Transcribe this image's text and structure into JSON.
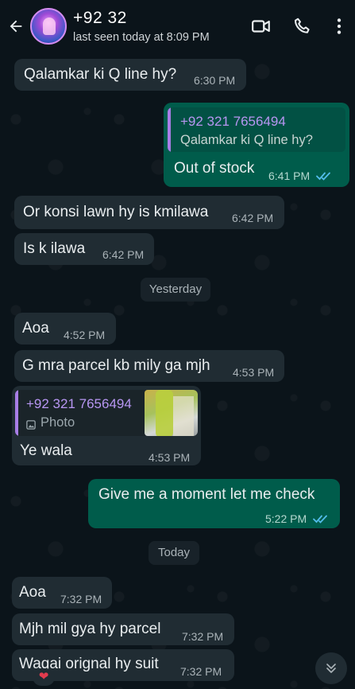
{
  "header": {
    "contact_name": "+92 32",
    "status": "last seen today at 8:09 PM"
  },
  "messages": [
    {
      "text": "Qalamkar ki Q line hy?",
      "time": "6:30 PM"
    },
    {
      "quote_author": "+92 321 7656494",
      "quote_text": "Qalamkar ki Q line hy?",
      "text": "Out of stock",
      "time": "6:41 PM"
    },
    {
      "text": "Or konsi lawn hy is kmilawa",
      "time": "6:42 PM"
    },
    {
      "text": "Is k ilawa",
      "time": "6:42 PM"
    },
    {
      "text": "Aoa",
      "time": "4:52 PM"
    },
    {
      "text": "G mra parcel kb mily ga mjh",
      "time": "4:53 PM"
    },
    {
      "quote_author": "+92 321 7656494",
      "quote_text": "Photo",
      "text": "Ye wala",
      "time": "4:53 PM"
    },
    {
      "text": "Give me a moment let me check",
      "time": "5:22 PM"
    },
    {
      "text": "Aoa",
      "time": "7:32 PM"
    },
    {
      "text": "Mjh mil gya hy parcel",
      "time": "7:32 PM"
    },
    {
      "text": "Waqai orignal hy suit",
      "time": "7:32 PM"
    }
  ],
  "dates": {
    "yesterday": "Yesterday",
    "today": "Today"
  },
  "colors": {
    "incoming": "#202c33",
    "outgoing": "#005c4b",
    "read_ticks": "#53bdeb",
    "background": "#0b141a"
  },
  "icons": [
    "back-arrow-icon",
    "video-call-icon",
    "voice-call-icon",
    "more-options-icon",
    "double-check-icon",
    "photo-icon",
    "scroll-down-icon",
    "heart-reaction-icon"
  ]
}
